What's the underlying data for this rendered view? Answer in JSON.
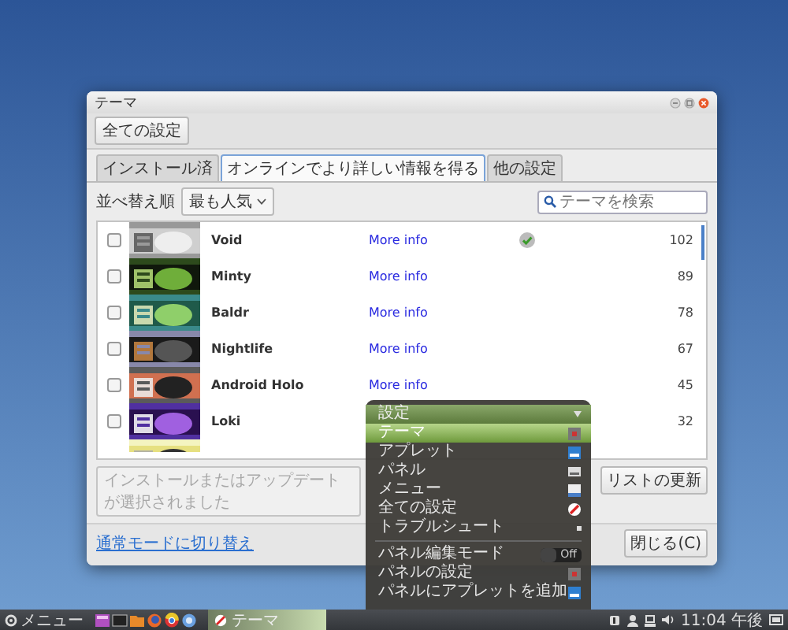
{
  "window": {
    "title": "テーマ",
    "toolbar_button": "全ての設定"
  },
  "tabs": [
    {
      "label": "インストール済",
      "selected": false
    },
    {
      "label": "オンラインでより詳しい情報を得る",
      "selected": true
    },
    {
      "label": "他の設定",
      "selected": false
    }
  ],
  "sort": {
    "label": "並べ替え順",
    "value": "最も人気"
  },
  "search": {
    "placeholder": "テーマを検索"
  },
  "themes": [
    {
      "name": "Void",
      "more_info": "More info",
      "installed": true,
      "checked": false,
      "count": "102"
    },
    {
      "name": "Minty",
      "more_info": "More info",
      "installed": false,
      "checked": false,
      "count": "89"
    },
    {
      "name": "Baldr",
      "more_info": "More info",
      "installed": false,
      "checked": false,
      "count": "78"
    },
    {
      "name": "Nightlife",
      "more_info": "More info",
      "installed": false,
      "checked": false,
      "count": "67"
    },
    {
      "name": "Android Holo",
      "more_info": "More info",
      "installed": false,
      "checked": false,
      "count": "45"
    },
    {
      "name": "Loki",
      "installed": false,
      "checked": false,
      "count": "32"
    }
  ],
  "install_button": {
    "label": "インストールまたはアップデートが選択されました",
    "disabled": true
  },
  "refresh_button": "リストの更新",
  "close_button": "閉じる(C)",
  "footer_link": "通常モードに切り替え",
  "menu": {
    "items": [
      {
        "kind": "header",
        "label": "設定"
      },
      {
        "kind": "item",
        "label": "テーマ",
        "selected": true
      },
      {
        "kind": "item",
        "label": "アプレット",
        "selected": false
      },
      {
        "kind": "item",
        "label": "パネル",
        "selected": false
      },
      {
        "kind": "item",
        "label": "メニュー",
        "selected": false
      },
      {
        "kind": "item",
        "label": "全ての設定",
        "selected": false
      },
      {
        "kind": "submenu",
        "label": "トラブルシュート",
        "selected": false
      },
      {
        "kind": "separator"
      },
      {
        "kind": "toggle",
        "label": "パネル編集モード",
        "selected": false,
        "on": false,
        "state_label": "Off"
      },
      {
        "kind": "item",
        "label": "パネルの設定",
        "selected": false
      },
      {
        "kind": "item",
        "label": "パネルにアプレットを追加",
        "selected": false
      }
    ]
  },
  "taskbar": {
    "menu_label": "メニュー",
    "tasks": [
      {
        "label": "テーマ",
        "selected": true
      }
    ],
    "clock": "11:04 午後"
  }
}
